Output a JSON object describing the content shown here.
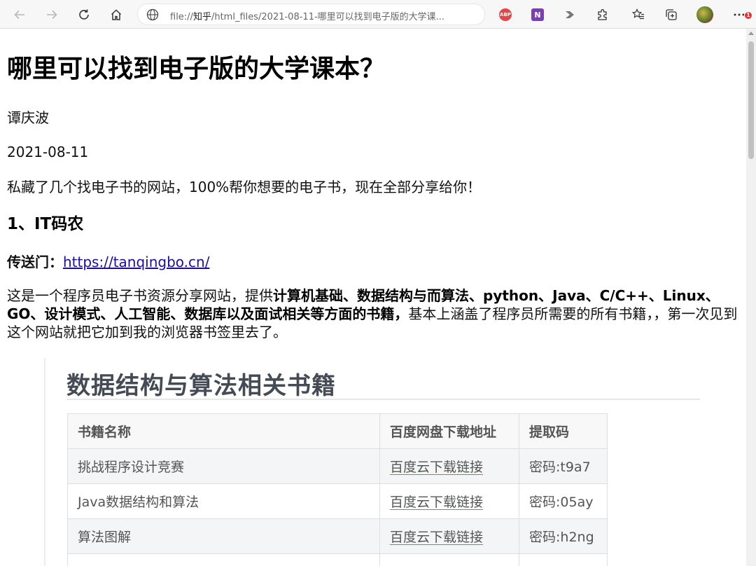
{
  "browser": {
    "address_prefix": "file://",
    "address_host": "知乎",
    "address_rest": "/html_files/2021-08-11-哪里可以找到电子版的大学课...",
    "extensions": [
      "abp-icon",
      "onenote-icon",
      "arrow-icon",
      "puzzle-icon"
    ],
    "notification_count": "1"
  },
  "article": {
    "title": "哪里可以找到电子版的大学课本？",
    "author": "谭庆波",
    "date": "2021-08-11",
    "intro": "私藏了几个找电子书的网站，100%帮你想要的电子书，现在全部分享给你！",
    "section1_heading": "1、IT码农",
    "portal_label": "传送门：",
    "portal_link": "https://tanqingbo.cn/",
    "para_start": "这是一个程序员电子书资源分享网站，提供",
    "para_bold": "计算机基础、数据结构与而算法、python、Java、C/C++、Linux、GO、设计模式、人工智能、数据库以及面试相关等方面的书籍，",
    "para_end": "基本上涵盖了程序员所需要的所有书籍，，第一次见到这个网站就把它加到我的浏览器书签里去了。"
  },
  "figure": {
    "title": "数据结构与算法相关书籍",
    "headers": [
      "书籍名称",
      "百度网盘下载地址",
      "提取码"
    ],
    "rows": [
      {
        "name": "挑战程序设计竞赛",
        "link": "百度云下载链接",
        "code": "密码:t9a7"
      },
      {
        "name": "Java数据结构和算法",
        "link": "百度云下载链接",
        "code": "密码:05ay"
      },
      {
        "name": "算法图解",
        "link": "百度云下载链接",
        "code": "密码:h2ng"
      }
    ]
  },
  "colors": {
    "link": "#1a0dab",
    "download_underline": "#e0566c",
    "figure_title": "#444b55"
  }
}
